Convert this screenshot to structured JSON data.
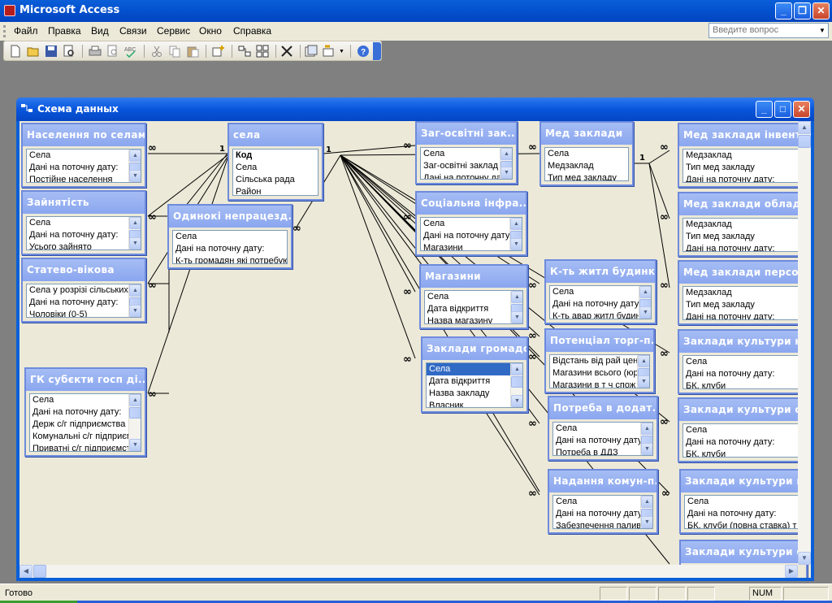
{
  "app": {
    "title": "Microsoft Access",
    "controls": {
      "minimize": "_",
      "restore": "❐",
      "close": "✕"
    }
  },
  "menu": {
    "items": [
      "Файл",
      "Правка",
      "Вид",
      "Связи",
      "Сервис",
      "Окно",
      "Справка"
    ],
    "help_placeholder": "Введите вопрос"
  },
  "toolbar": {
    "buttons": [
      "new-icon",
      "open-icon",
      "save-icon",
      "search-icon",
      "print-icon",
      "print-preview-icon",
      "spelling-icon",
      "cut-icon",
      "copy-icon",
      "paste-icon",
      "show-table-icon",
      "show-direct-icon",
      "show-all-icon",
      "delete-icon",
      "new-object-icon",
      "office-links-icon",
      "help-icon"
    ]
  },
  "window": {
    "title": "Схема данных",
    "controls": {
      "minimize": "_",
      "maximize": "□",
      "close": "✕"
    }
  },
  "tables": [
    {
      "title": "Населення по селам",
      "fields": [
        "Села",
        "Дані на поточну дату:",
        "Постійне населення"
      ]
    },
    {
      "title": "Зайнятість",
      "fields": [
        "Села",
        "Дані на поточну дату:",
        "Усього зайнято"
      ]
    },
    {
      "title": "Статево-вікова",
      "fields": [
        "Села у розрізі сільських р",
        "Дані на поточну дату:",
        "Чоловіки (0-5)"
      ]
    },
    {
      "title": "ГК субєкти госп ді...",
      "fields": [
        "Села",
        "Дані на поточну дату:",
        "Держ с/г підприємства",
        "Комунальні с/г підприєм",
        "Приватні с/г підприємст"
      ]
    },
    {
      "title": "Одинокі непрацезд...",
      "fields": [
        "Села",
        "Дані на поточну дату:",
        "К-ть громадян які потребуют"
      ]
    },
    {
      "title": "села",
      "fields": [
        "Код",
        "Села",
        "Сільська рада",
        "Район"
      ]
    },
    {
      "title": "Заг-освітні зак...",
      "fields": [
        "Села",
        "Заг-освітні заклад",
        "Дані на поточну да"
      ]
    },
    {
      "title": "Соціальна інфра...",
      "fields": [
        "Села",
        "Дані на поточну дату",
        "Магазини"
      ]
    },
    {
      "title": "Магазини",
      "fields": [
        "Села",
        "Дата відкриття",
        "Назва магазину"
      ]
    },
    {
      "title": "Заклади громадс...",
      "fields": [
        "Села",
        "Дата відкриття",
        "Назва закладу",
        "Власник"
      ]
    },
    {
      "title": "Мед заклади",
      "fields": [
        "Села",
        "Медзаклад",
        "Тип мед закладу"
      ]
    },
    {
      "title": "К-ть житл будинків",
      "fields": [
        "Села",
        "Дані на поточну дату",
        "К-ть авар житл будин"
      ]
    },
    {
      "title": "Потенціал торг-п...",
      "fields": [
        "Відстань від рай цент",
        "Магазини всього (юр",
        "Магазини в т ч спож к"
      ]
    },
    {
      "title": "Потреба в додат...",
      "fields": [
        "Села",
        "Дані на поточну дату",
        "Потреба в ДДЗ"
      ]
    },
    {
      "title": "Надання комун-п...",
      "fields": [
        "Села",
        "Дані на поточну дату",
        "Забезпечення палив"
      ]
    },
    {
      "title": "Мед заклади інвента...",
      "fields": [
        "Медзаклад",
        "Тип мед закладу",
        "Дані на поточну дату:"
      ]
    },
    {
      "title": "Мед заклади обладн...",
      "fields": [
        "Медзаклад",
        "Тип мед закладу",
        "Дані на поточну дату:"
      ]
    },
    {
      "title": "Мед заклади персонал...",
      "fields": [
        "Медзаклад",
        "Тип мед закладу",
        "Дані на поточну дату:"
      ]
    },
    {
      "title": "Заклади культури на...",
      "fields": [
        "Села",
        "Дані на поточну дату:",
        "БК, клуби"
      ]
    },
    {
      "title": "Заклади культури опа...",
      "fields": [
        "Села",
        "Дані на поточну дату:",
        "БК, клуби"
      ]
    },
    {
      "title": "Заклади культури к-т...",
      "fields": [
        "Села",
        "Дані на поточну дату:",
        "БК, клуби (повна ставка) т"
      ]
    },
    {
      "title": "Заклади культури ста...",
      "fields": []
    }
  ],
  "cardinality": {
    "one": "1",
    "many": "∞"
  },
  "status": {
    "text": "Готово",
    "num": "NUM"
  },
  "colors": {
    "titlebar": "#0a5fd8",
    "table_header": "#98b1f2",
    "canvas": "#ece9d8",
    "selection": "#316ac5"
  }
}
